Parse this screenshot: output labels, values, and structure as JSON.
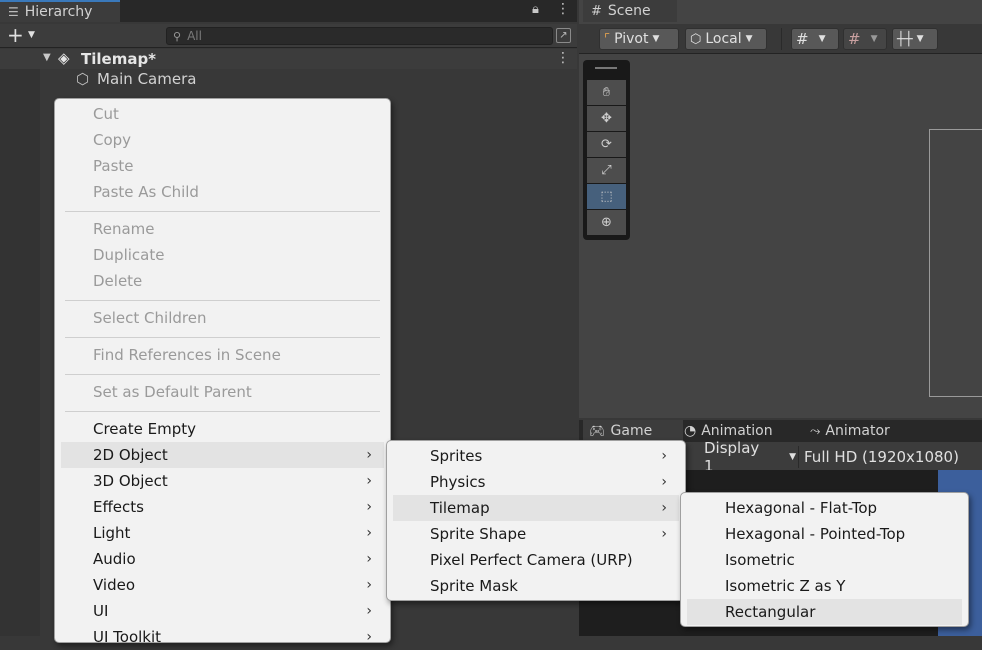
{
  "hierarchy": {
    "tab_label": "Hierarchy",
    "search_placeholder": "All",
    "scene_name": "Tilemap*",
    "objects": [
      "Main Camera"
    ]
  },
  "scene": {
    "tab_label": "Scene",
    "pivot_label": "Pivot",
    "local_label": "Local"
  },
  "game": {
    "tabs": [
      "Game",
      "Animation",
      "Animator"
    ],
    "display_label": "Display 1",
    "resolution_label": "Full HD (1920x1080)"
  },
  "context_menu": {
    "items": [
      {
        "label": "Cut",
        "enabled": false
      },
      {
        "label": "Copy",
        "enabled": false
      },
      {
        "label": "Paste",
        "enabled": false
      },
      {
        "label": "Paste As Child",
        "enabled": false
      },
      {
        "label": "Rename",
        "enabled": false
      },
      {
        "label": "Duplicate",
        "enabled": false
      },
      {
        "label": "Delete",
        "enabled": false
      },
      {
        "label": "Select Children",
        "enabled": false
      },
      {
        "label": "Find References in Scene",
        "enabled": false
      },
      {
        "label": "Set as Default Parent",
        "enabled": false
      },
      {
        "label": "Create Empty",
        "enabled": true
      },
      {
        "label": "2D Object",
        "enabled": true,
        "submenu": true
      },
      {
        "label": "3D Object",
        "enabled": true,
        "submenu": true
      },
      {
        "label": "Effects",
        "enabled": true,
        "submenu": true
      },
      {
        "label": "Light",
        "enabled": true,
        "submenu": true
      },
      {
        "label": "Audio",
        "enabled": true,
        "submenu": true
      },
      {
        "label": "Video",
        "enabled": true,
        "submenu": true
      },
      {
        "label": "UI",
        "enabled": true,
        "submenu": true
      },
      {
        "label": "UI Toolkit",
        "enabled": true,
        "submenu": true
      }
    ]
  },
  "submenu_2d": {
    "items": [
      {
        "label": "Sprites",
        "submenu": true
      },
      {
        "label": "Physics",
        "submenu": true
      },
      {
        "label": "Tilemap",
        "submenu": true
      },
      {
        "label": "Sprite Shape",
        "submenu": true
      },
      {
        "label": "Pixel Perfect Camera (URP)",
        "submenu": false
      },
      {
        "label": "Sprite Mask",
        "submenu": false
      }
    ]
  },
  "submenu_tilemap": {
    "items": [
      "Hexagonal - Flat-Top",
      "Hexagonal - Pointed-Top",
      "Isometric",
      "Isometric Z as Y",
      "Rectangular"
    ]
  },
  "colors": {
    "accent": "#3a79bb",
    "menu_bg": "#f2f2f2",
    "active_tool": "#46607c"
  }
}
